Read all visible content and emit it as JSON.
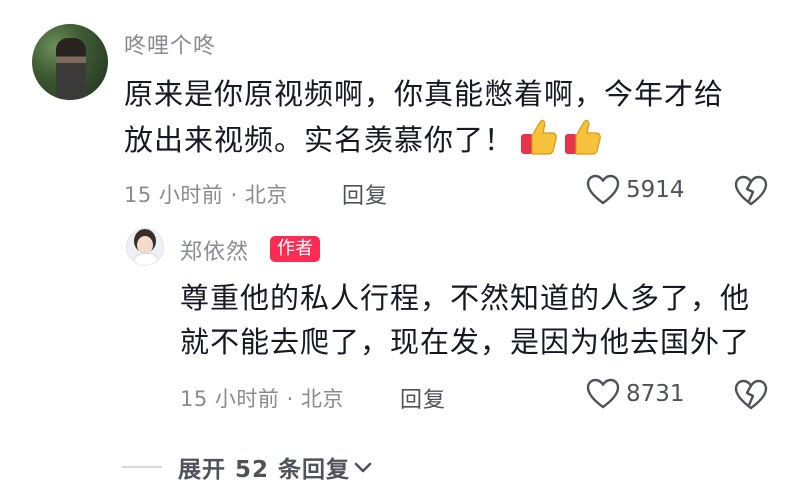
{
  "comment": {
    "username": "咚哩个咚",
    "text_line1": "原来是你原视频啊，你真能憋着啊，今年才给",
    "text_line2": "放出来视频。实名羡慕你了！",
    "time_location": "15 小时前 · 北京",
    "reply_label": "回复",
    "like_count": "5914"
  },
  "reply": {
    "username": "郑依然",
    "badge": "作者",
    "text_line1": "尊重他的私人行程，不然知道的人多了，他",
    "text_line2": "就不能去爬了，现在发，是因为他去国外了",
    "time_location": "15 小时前 · 北京",
    "reply_label": "回复",
    "like_count": "8731"
  },
  "expand": {
    "label": "展开 52 条回复"
  }
}
